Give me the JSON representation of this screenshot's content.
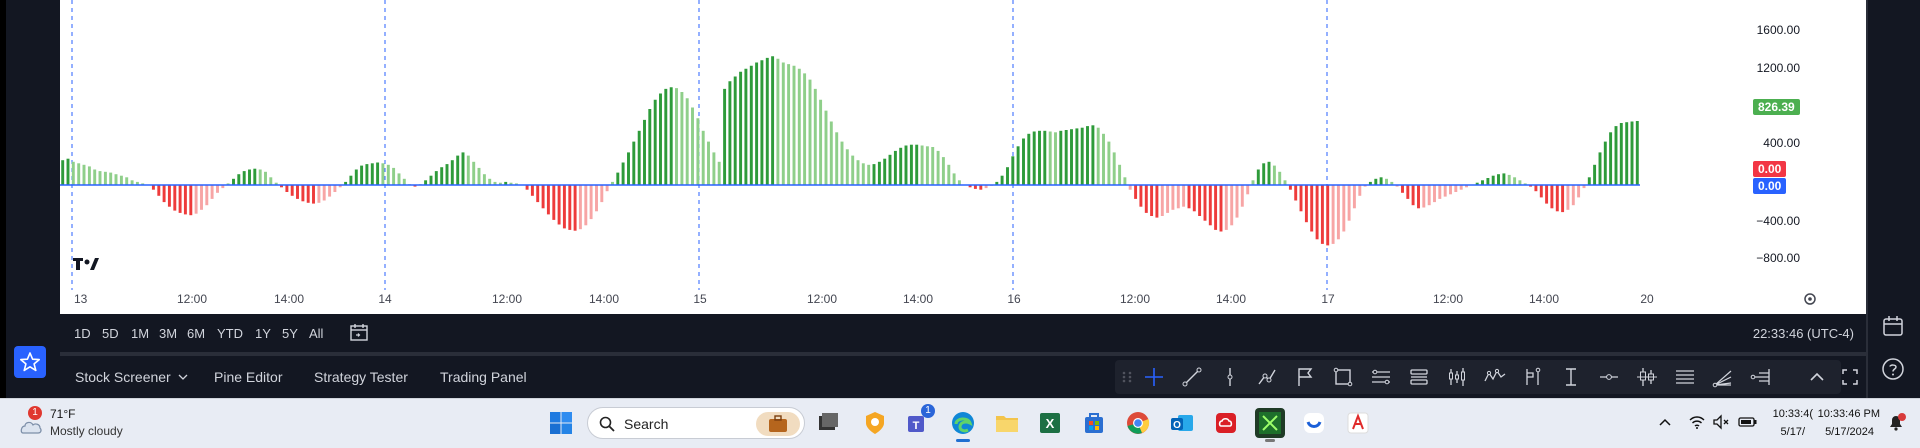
{
  "chart": {
    "x_labels": [
      "13",
      "12:00",
      "14:00",
      "14",
      "12:00",
      "14:00",
      "15",
      "12:00",
      "14:00",
      "16",
      "12:00",
      "14:00",
      "17",
      "12:00",
      "14:00",
      "20"
    ],
    "y_labels": [
      "1600.00",
      "1200.00",
      "400.00",
      "−400.00",
      "−800.00"
    ],
    "price_tags": [
      {
        "value": "826.39",
        "color": "#4caf50"
      },
      {
        "value": "0.00",
        "color": "#f23645"
      },
      {
        "value": "0.00",
        "color": "#2962ff"
      }
    ],
    "colors": {
      "up_strong": "#2e9b3a",
      "up_weak": "#8fcf8a",
      "down_strong": "#ee3b3b",
      "down_weak": "#f7a5a5",
      "zero_line": "#2962ff",
      "session_line": "#2962ff"
    }
  },
  "chart_data": {
    "type": "bar",
    "title": "",
    "ylim": [
      -1000,
      1800
    ],
    "values": [
      320,
      340,
      300,
      280,
      260,
      240,
      200,
      180,
      170,
      160,
      140,
      120,
      100,
      60,
      40,
      20,
      0,
      -60,
      -140,
      -220,
      -280,
      -330,
      -360,
      -380,
      -390,
      -370,
      -320,
      -260,
      -180,
      -100,
      -40,
      20,
      80,
      140,
      180,
      200,
      210,
      200,
      170,
      100,
      30,
      -30,
      -90,
      -140,
      -180,
      -210,
      -230,
      -240,
      -230,
      -200,
      -150,
      -90,
      -30,
      40,
      120,
      200,
      250,
      270,
      280,
      290,
      280,
      260,
      220,
      150,
      80,
      10,
      -20,
      10,
      60,
      120,
      180,
      230,
      270,
      320,
      380,
      420,
      380,
      300,
      220,
      140,
      80,
      40,
      30,
      40,
      30,
      20,
      0,
      -60,
      -140,
      -220,
      -300,
      -380,
      -450,
      -510,
      -560,
      -580,
      -590,
      -570,
      -520,
      -440,
      -340,
      -220,
      -80,
      40,
      160,
      290,
      420,
      560,
      700,
      840,
      980,
      1100,
      1180,
      1240,
      1260,
      1250,
      1200,
      1120,
      1000,
      860,
      700,
      560,
      420,
      300,
      1240,
      1340,
      1400,
      1460,
      1500,
      1540,
      1580,
      1610,
      1640,
      1660,
      1630,
      1580,
      1560,
      1540,
      1500,
      1440,
      1360,
      1240,
      1100,
      960,
      820,
      680,
      560,
      460,
      380,
      320,
      280,
      260,
      270,
      300,
      340,
      390,
      440,
      480,
      510,
      520,
      520,
      510,
      500,
      490,
      440,
      360,
      260,
      150,
      60,
      0,
      -30,
      -50,
      -60,
      -40,
      -10,
      40,
      120,
      230,
      370,
      500,
      600,
      660,
      690,
      700,
      700,
      690,
      680,
      700,
      710,
      720,
      730,
      740,
      760,
      770,
      740,
      660,
      560,
      420,
      260,
      100,
      -60,
      -180,
      -280,
      -360,
      -400,
      -420,
      -400,
      -360,
      -320,
      -300,
      -280,
      -300,
      -340,
      -400,
      -460,
      -520,
      -580,
      -600,
      -580,
      -520,
      -420,
      -280,
      -120,
      60,
      200,
      280,
      300,
      250,
      170,
      60,
      -60,
      -200,
      -340,
      -480,
      -600,
      -700,
      -760,
      -780,
      -760,
      -700,
      -600,
      -460,
      -300,
      -140,
      -20,
      40,
      80,
      100,
      80,
      40,
      -20,
      -100,
      -180,
      -260,
      -300,
      -290,
      -260,
      -220,
      -180,
      -150,
      -120,
      -90,
      -60,
      -30,
      0,
      30,
      60,
      90,
      120,
      140,
      150,
      130,
      100,
      60,
      20,
      -20,
      -80,
      -160,
      -240,
      -300,
      -340,
      -350,
      -320,
      -260,
      -160,
      -40,
      100,
      260,
      420,
      560,
      680,
      760,
      800,
      810,
      820,
      826
    ]
  },
  "range_bar": {
    "buttons": [
      "1D",
      "5D",
      "1M",
      "3M",
      "6M",
      "YTD",
      "1Y",
      "5Y",
      "All"
    ],
    "clock": "22:33:46 (UTC-4)"
  },
  "panel_bar": {
    "tabs": [
      "Stock Screener",
      "Pine Editor",
      "Strategy Tester",
      "Trading Panel"
    ]
  },
  "taskbar": {
    "weather_badge": "1",
    "weather_temp": "71°F",
    "weather_desc": "Mostly cloudy",
    "search_placeholder": "Search",
    "teams_badge": "1",
    "tray_time_1": "10:33:4(",
    "tray_date_1": "5/17/",
    "tray_time_2": "10:33:46 PM",
    "tray_date_2": "5/17/2024"
  }
}
